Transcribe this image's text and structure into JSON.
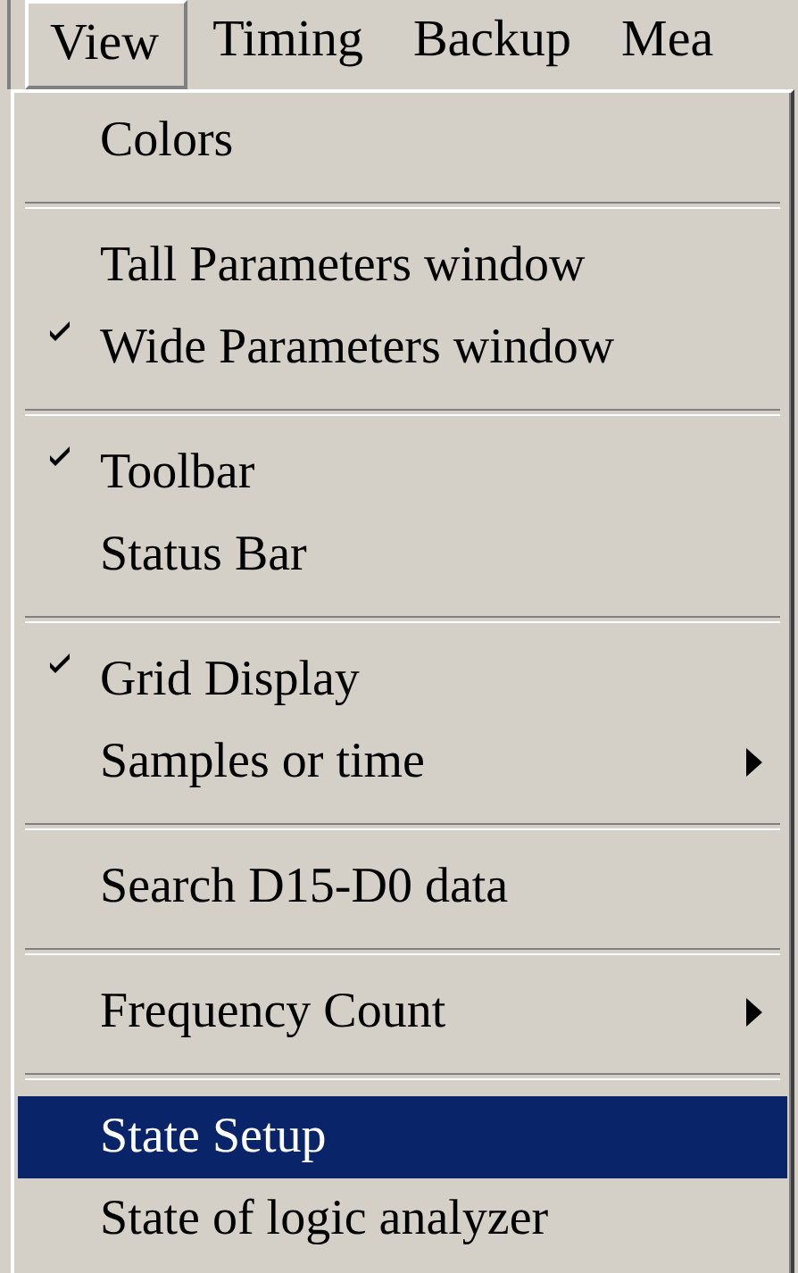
{
  "menu_bar": [
    {
      "label": "View",
      "selected": true
    },
    {
      "label": "Timing",
      "selected": false
    },
    {
      "label": "Backup",
      "selected": false
    },
    {
      "label": "Mea",
      "selected": false
    }
  ],
  "menu": [
    {
      "kind": "item",
      "label": "Colors",
      "checked": false,
      "submenu": false,
      "selected": false
    },
    {
      "kind": "separator"
    },
    {
      "kind": "item",
      "label": "Tall Parameters window",
      "checked": false,
      "submenu": false,
      "selected": false
    },
    {
      "kind": "item",
      "label": "Wide Parameters window",
      "checked": true,
      "submenu": false,
      "selected": false
    },
    {
      "kind": "separator"
    },
    {
      "kind": "item",
      "label": "Toolbar",
      "checked": true,
      "submenu": false,
      "selected": false
    },
    {
      "kind": "item",
      "label": "Status Bar",
      "checked": false,
      "submenu": false,
      "selected": false
    },
    {
      "kind": "separator"
    },
    {
      "kind": "item",
      "label": "Grid Display",
      "checked": true,
      "submenu": false,
      "selected": false
    },
    {
      "kind": "item",
      "label": "Samples or time",
      "checked": false,
      "submenu": true,
      "selected": false
    },
    {
      "kind": "separator"
    },
    {
      "kind": "item",
      "label": "Search D15-D0 data",
      "checked": false,
      "submenu": false,
      "selected": false
    },
    {
      "kind": "separator"
    },
    {
      "kind": "item",
      "label": "Frequency Count",
      "checked": false,
      "submenu": true,
      "selected": false
    },
    {
      "kind": "separator"
    },
    {
      "kind": "item",
      "label": "State Setup",
      "checked": false,
      "submenu": false,
      "selected": true
    },
    {
      "kind": "item",
      "label": "State of logic analyzer",
      "checked": false,
      "submenu": false,
      "selected": false
    }
  ]
}
